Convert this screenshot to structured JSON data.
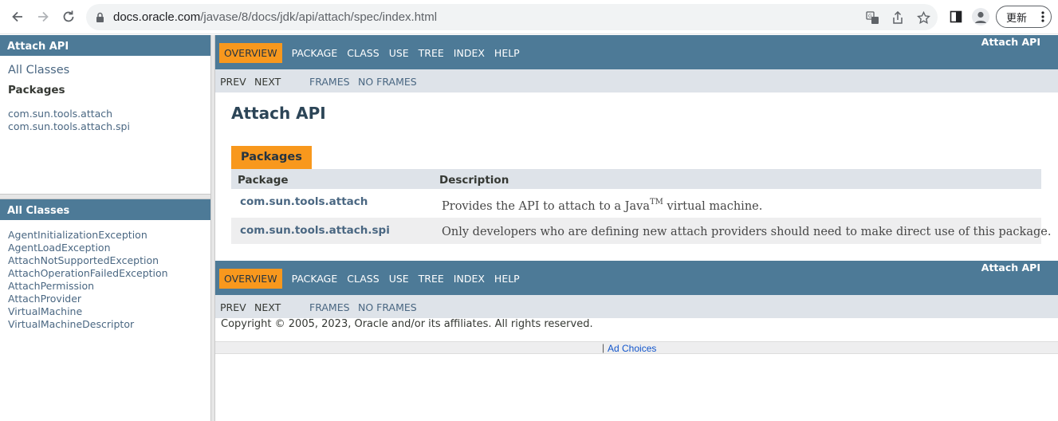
{
  "browser": {
    "url_host": "docs.oracle.com",
    "url_path": "/javase/8/docs/jdk/api/attach/spec/index.html",
    "update_label": "更新",
    "icons": [
      "back-icon",
      "forward-icon",
      "reload-icon",
      "lock-icon",
      "translate-icon",
      "share-icon",
      "star-icon",
      "sidepanel-icon",
      "profile-icon",
      "more-icon"
    ]
  },
  "left_top": {
    "header": "Attach API",
    "all_classes_link": "All Classes",
    "packages_title": "Packages",
    "packages": [
      "com.sun.tools.attach",
      "com.sun.tools.attach.spi"
    ]
  },
  "left_bottom": {
    "header": "All Classes",
    "classes": [
      "AgentInitializationException",
      "AgentLoadException",
      "AttachNotSupportedException",
      "AttachOperationFailedException",
      "AttachPermission",
      "AttachProvider",
      "VirtualMachine",
      "VirtualMachineDescriptor"
    ]
  },
  "nav": {
    "items": [
      "OVERVIEW",
      "PACKAGE",
      "CLASS",
      "USE",
      "TREE",
      "INDEX",
      "HELP"
    ],
    "about": "Attach API",
    "prev": "PREV",
    "next": "NEXT",
    "frames": "FRAMES",
    "no_frames": "NO FRAMES"
  },
  "main": {
    "title": "Attach API",
    "caption": "Packages",
    "col_package": "Package",
    "col_description": "Description",
    "rows": [
      {
        "package": "com.sun.tools.attach",
        "desc_before": "Provides the API to attach to a Java",
        "desc_sup": "TM",
        "desc_after": " virtual machine."
      },
      {
        "package": "com.sun.tools.attach.spi",
        "desc": "Only developers who are defining new attach providers should need to make direct use of this package."
      }
    ],
    "copyright": "Copyright © 2005, 2023, Oracle and/or its affiliates. All rights reserved.",
    "ad_separator": "|",
    "ad_choices": "Ad Choices"
  },
  "colors": {
    "nav_bar": "#4d7a97",
    "active_tab": "#f8981d",
    "sub_nav": "#dee3e9",
    "link": "#4a6782"
  }
}
